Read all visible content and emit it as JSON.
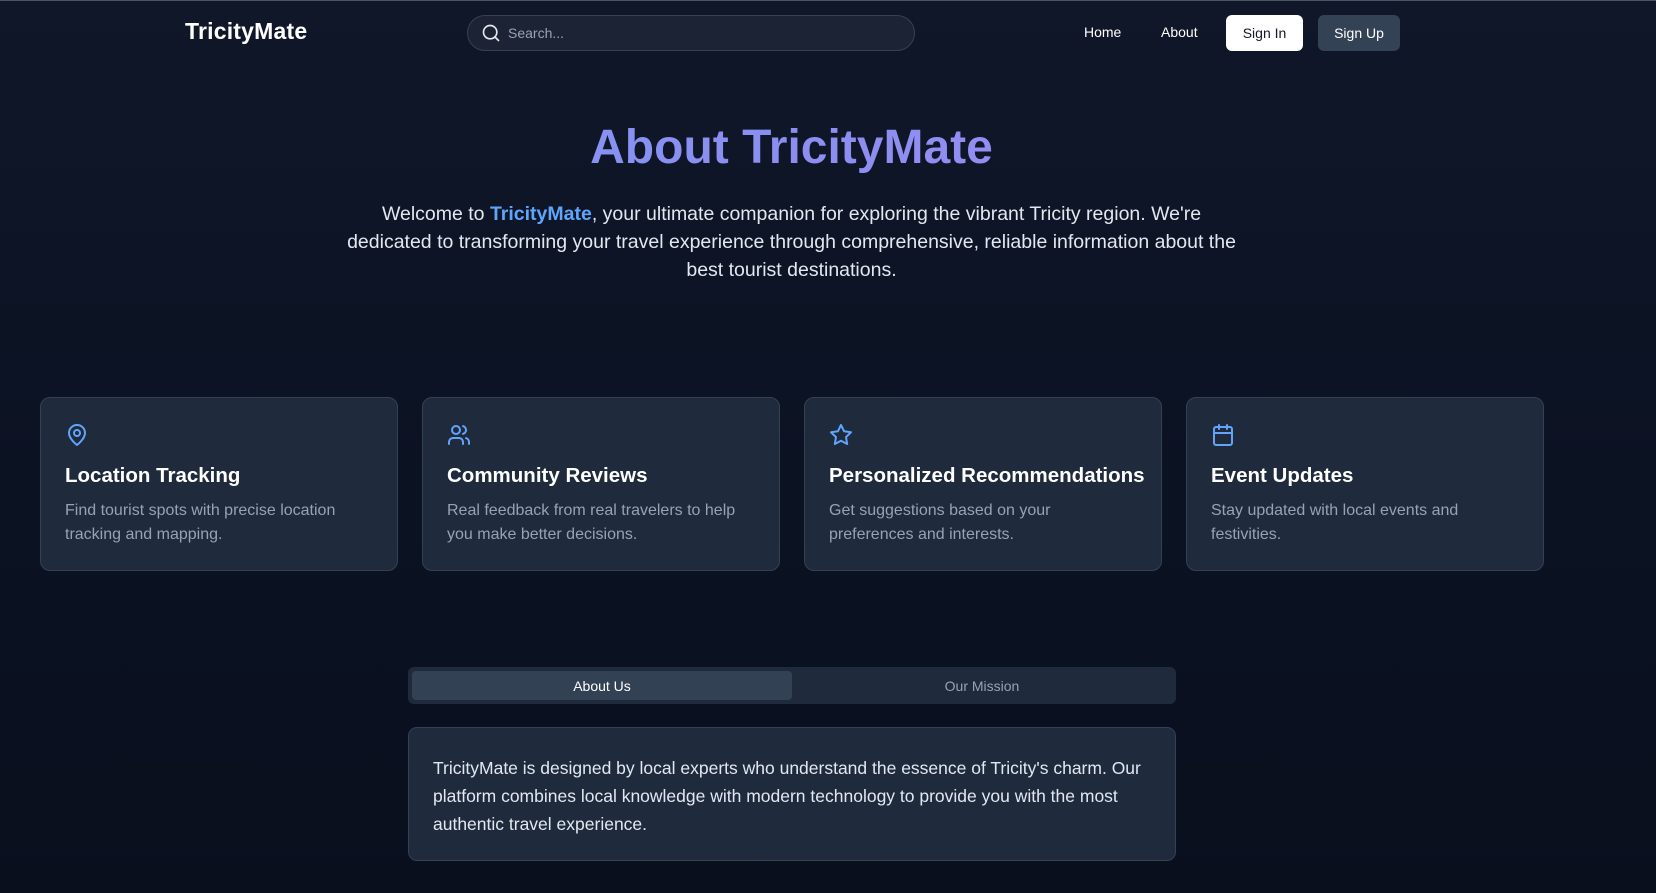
{
  "header": {
    "brand": "TricityMate",
    "search": {
      "placeholder": "Search...",
      "value": ""
    },
    "nav": {
      "home": "Home",
      "about": "About"
    },
    "sign_in": "Sign In",
    "sign_up": "Sign Up"
  },
  "hero": {
    "title": "About TricityMate",
    "intro_prefix": "Welcome to ",
    "intro_highlight": "TricityMate",
    "intro_suffix": ", your ultimate companion for exploring the vibrant Tricity region. We're dedicated to transforming your travel experience through comprehensive, reliable information about the best tourist destinations."
  },
  "features": [
    {
      "icon": "map-pin-icon",
      "title": "Location Tracking",
      "description": "Find tourist spots with precise location tracking and mapping."
    },
    {
      "icon": "users-icon",
      "title": "Community Reviews",
      "description": "Real feedback from real travelers to help you make better decisions."
    },
    {
      "icon": "star-icon",
      "title": "Personalized Recommendations",
      "description": "Get suggestions based on your preferences and interests."
    },
    {
      "icon": "calendar-icon",
      "title": "Event Updates",
      "description": "Stay updated with local events and festivities."
    }
  ],
  "tabs": {
    "items": [
      {
        "label": "About Us",
        "active": true
      },
      {
        "label": "Our Mission",
        "active": false
      }
    ],
    "panel_text": "TricityMate is designed by local experts who understand the essence of Tricity's charm. Our platform combines local knowledge with modern technology to provide you with the most authentic travel experience."
  },
  "colors": {
    "background": "#0f1729",
    "card": "#1f2a3c",
    "accent": "#60a5fa",
    "title_gradient_start": "#7c9cf5",
    "title_gradient_end": "#a78bfa"
  }
}
